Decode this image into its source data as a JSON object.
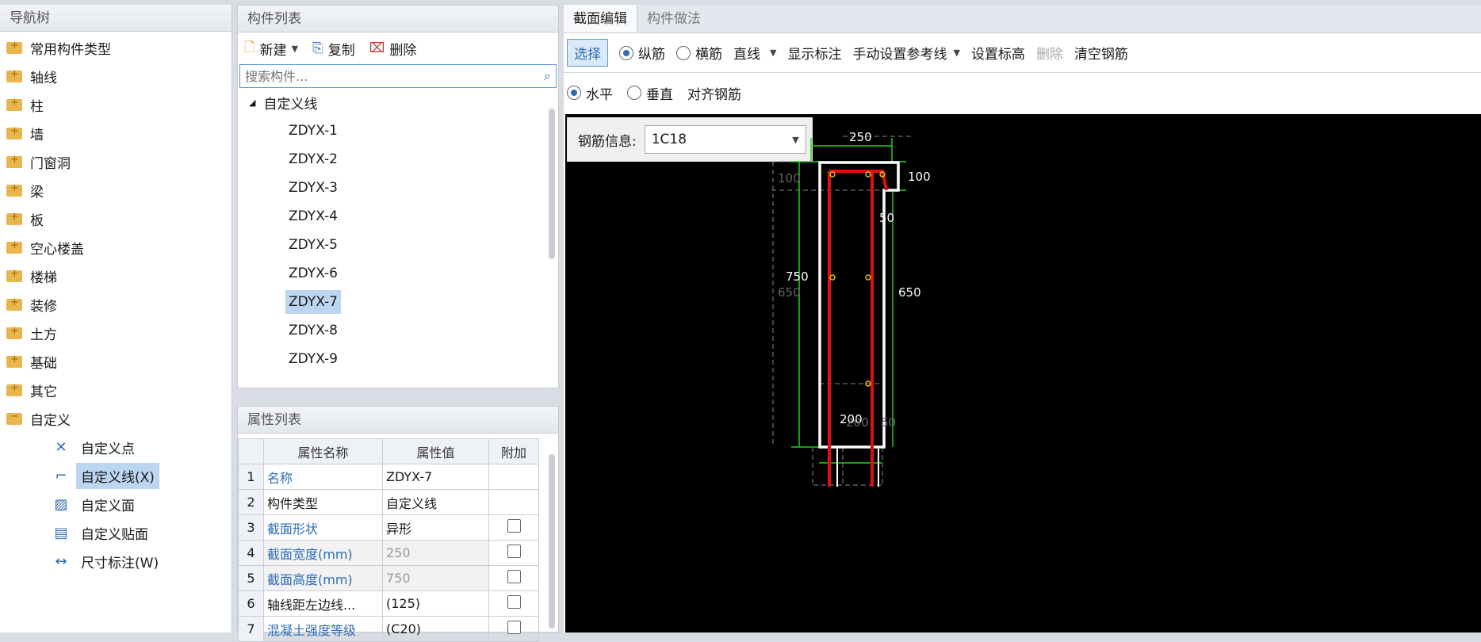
{
  "nav": {
    "title": "导航树",
    "items": [
      "常用构件类型",
      "轴线",
      "柱",
      "墙",
      "门窗洞",
      "梁",
      "板",
      "空心楼盖",
      "楼梯",
      "装修",
      "土方",
      "基础",
      "其它",
      "自定义"
    ],
    "sub_items": [
      "自定义点",
      "自定义线(X)",
      "自定义面",
      "自定义贴面",
      "尺寸标注(W)"
    ]
  },
  "components": {
    "title": "构件列表",
    "toolbar": {
      "new": "新建",
      "copy": "复制",
      "delete": "删除"
    },
    "search_placeholder": "搜索构件...",
    "root": "自定义线",
    "items": [
      "ZDYX-1",
      "ZDYX-2",
      "ZDYX-3",
      "ZDYX-4",
      "ZDYX-5",
      "ZDYX-6",
      "ZDYX-7",
      "ZDYX-8",
      "ZDYX-9"
    ],
    "selected": "ZDYX-7"
  },
  "props": {
    "title": "属性列表",
    "headers": [
      "属性名称",
      "属性值",
      "附加"
    ],
    "rows": [
      {
        "n": "1",
        "name": "名称",
        "value": "ZDYX-7"
      },
      {
        "n": "2",
        "name": "构件类型",
        "value": "自定义线"
      },
      {
        "n": "3",
        "name": "截面形状",
        "value": "异形"
      },
      {
        "n": "4",
        "name": "截面宽度(mm)",
        "value": "250"
      },
      {
        "n": "5",
        "name": "截面高度(mm)",
        "value": "750"
      },
      {
        "n": "6",
        "name": "轴线距左边线...",
        "value": "(125)"
      },
      {
        "n": "7",
        "name": "混凝土强度等级",
        "value": "(C20)"
      }
    ]
  },
  "editor": {
    "tabs": [
      "截面编辑",
      "构件做法"
    ],
    "toolbar": {
      "select": "选择",
      "longitudinal": "纵筋",
      "transverse": "横筋",
      "line": "直线",
      "show_label": "显示标注",
      "manual_ref": "手动设置参考线",
      "set_elev": "设置标高",
      "delete": "删除",
      "clear": "清空钢筋"
    },
    "row2": {
      "horizontal": "水平",
      "vertical": "垂直",
      "align": "对齐钢筋"
    },
    "rebar_label": "钢筋信息:",
    "rebar_value": "1C18",
    "dims": {
      "top": "250",
      "right_top": "100",
      "left_top": "100",
      "left_total": "750",
      "left_sub": "650",
      "right_side": "650",
      "right_small": "50",
      "bottom": "200",
      "bottom_right": "50",
      "bottom_ghost": "200"
    }
  },
  "colors": {
    "accent": "#2e6db4",
    "rebar": "#e01010",
    "dim": "#1fd11f",
    "canvas": "#000000"
  }
}
